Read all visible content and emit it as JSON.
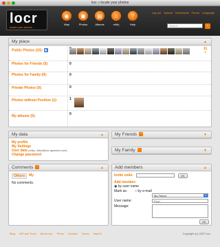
{
  "window": {
    "title": "locr » locate your photos"
  },
  "header": {
    "logo_text": "locr",
    "logo_slogan": "locate your photos",
    "nav": [
      {
        "label": "Map",
        "icon": "globe-icon"
      },
      {
        "label": "Photos",
        "icon": "camera-icon"
      },
      {
        "label": "Albums",
        "icon": "album-icon"
      },
      {
        "label": "mMy",
        "icon": "home-icon"
      },
      {
        "label": "Help",
        "icon": "help-icon"
      }
    ],
    "top_links": [
      "Log out",
      "Upload",
      "Downloads",
      "Forum",
      "Language"
    ],
    "search_placeholder": "Search..."
  },
  "myplace": {
    "title": "My place",
    "rows": [
      {
        "label": "Public Photos (33):",
        "count": "0"
      },
      {
        "label": "Photos for Friends (0):",
        "count": "0"
      },
      {
        "label": "Photos for Family (0):",
        "count": "0"
      },
      {
        "label": "Private Photos (0):",
        "count": "0"
      },
      {
        "label": "Photos without Position (1):",
        "count": "1"
      },
      {
        "label": "My albums (0):",
        "count": "0"
      }
    ],
    "pager_top": "11",
    "pager_bottom": "»"
  },
  "mydata": {
    "title": "My data",
    "links": [
      "My profile",
      "My Settings",
      "User data",
      "Change password"
    ],
    "user_data_note": "(mlky, mike@locr.rgsworld.com)"
  },
  "comments": {
    "title": "Comments",
    "tabs": [
      "Others",
      "My"
    ],
    "empty": "No comments."
  },
  "friends": {
    "title": "My Friends"
  },
  "family": {
    "title": "My Family"
  },
  "addmembers": {
    "title": "Add members",
    "invite_label": "Invite code:",
    "invite_btn": "OK",
    "add_label": "Add member:",
    "by_username": "by user name",
    "mark_as": "Mark as:",
    "by_email": "by e-mail",
    "mark_value": "My Friend",
    "username_label": "User name:",
    "username_value": "Find...",
    "message_label": "Message:",
    "ok_btn": "OK"
  },
  "footer": {
    "links": [
      "Blog",
      "API and Tools",
      "About locr",
      "Press",
      "Contact",
      "Terms",
      "Imprint"
    ],
    "copyright": "Copyright (c) 2007 locr"
  }
}
